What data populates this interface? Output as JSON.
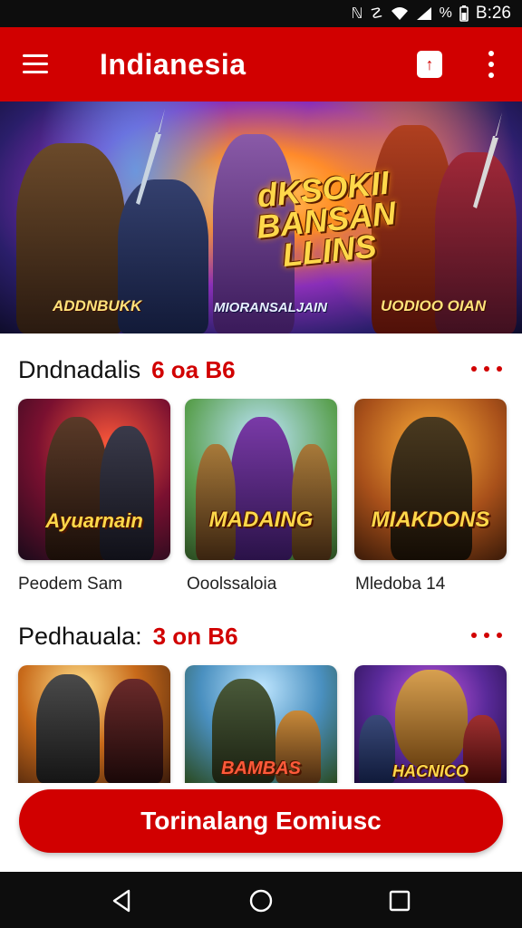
{
  "status_bar": {
    "time": "B:26",
    "icons": [
      "nfc-icon",
      "vibrate-icon",
      "wifi-icon",
      "signal-icon",
      "battery-icon"
    ],
    "battery_text": "%"
  },
  "app_bar": {
    "title": "Indianesia",
    "menu_icon": "hamburger-menu-icon",
    "action_icon": "upload-icon",
    "overflow_icon": "more-vert-icon"
  },
  "hero": {
    "headline_line1": "dKSOKII",
    "headline_line2": "BANSAN LLINS",
    "caption_left": "ADDNBUKK",
    "caption_center": "MIORANSALJAIN",
    "caption_right": "UODIOO OIAN"
  },
  "sections": [
    {
      "name": "Dndnadalis",
      "count": "6 oa B6",
      "items": [
        {
          "label": "Peodem Sam",
          "art_title": "Ayuarnain"
        },
        {
          "label": "Ooolssaloia",
          "art_title": "MADAING"
        },
        {
          "label": "Mledoba 14",
          "art_title": "MIAKDONS"
        }
      ]
    },
    {
      "name": "Pedhauala:",
      "count": "3 on B6",
      "items": [
        {
          "label": "",
          "art_title": ""
        },
        {
          "label": "",
          "art_title": "BAMBAS"
        },
        {
          "label": "",
          "art_title": "HACNICO"
        }
      ]
    }
  ],
  "cta": {
    "label": "Torinalang Eomiusc"
  },
  "nav_bar": {
    "buttons": [
      "back-icon",
      "home-icon",
      "recents-icon"
    ]
  },
  "colors": {
    "primary": "#d10000",
    "background": "#ffffff",
    "text": "#111111"
  }
}
